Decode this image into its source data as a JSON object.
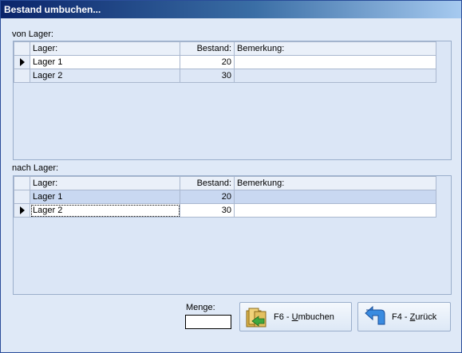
{
  "window": {
    "title": "Bestand umbuchen..."
  },
  "from_section": {
    "label": "von Lager:",
    "columns": [
      "Lager:",
      "Bestand:",
      "Bemerkung:"
    ],
    "rows": [
      {
        "lager": "Lager 1",
        "bestand": "20",
        "bemerkung": ""
      },
      {
        "lager": "Lager 2",
        "bestand": "30",
        "bemerkung": ""
      }
    ],
    "current_row": 0
  },
  "to_section": {
    "label": "nach Lager:",
    "columns": [
      "Lager:",
      "Bestand:",
      "Bemerkung:"
    ],
    "rows": [
      {
        "lager": "Lager 1",
        "bestand": "20",
        "bemerkung": ""
      },
      {
        "lager": "Lager 2",
        "bestand": "30",
        "bemerkung": ""
      }
    ],
    "current_row": 1
  },
  "menge": {
    "label": "Menge:",
    "value": ""
  },
  "buttons": {
    "umbuchen": {
      "prefix": "F6 - ",
      "mnemonic": "U",
      "rest": "mbuchen",
      "icon": "folder-transfer-icon"
    },
    "zurueck": {
      "prefix": "F4 - ",
      "mnemonic": "Z",
      "rest": "urück",
      "icon": "return-arrow-icon"
    }
  }
}
